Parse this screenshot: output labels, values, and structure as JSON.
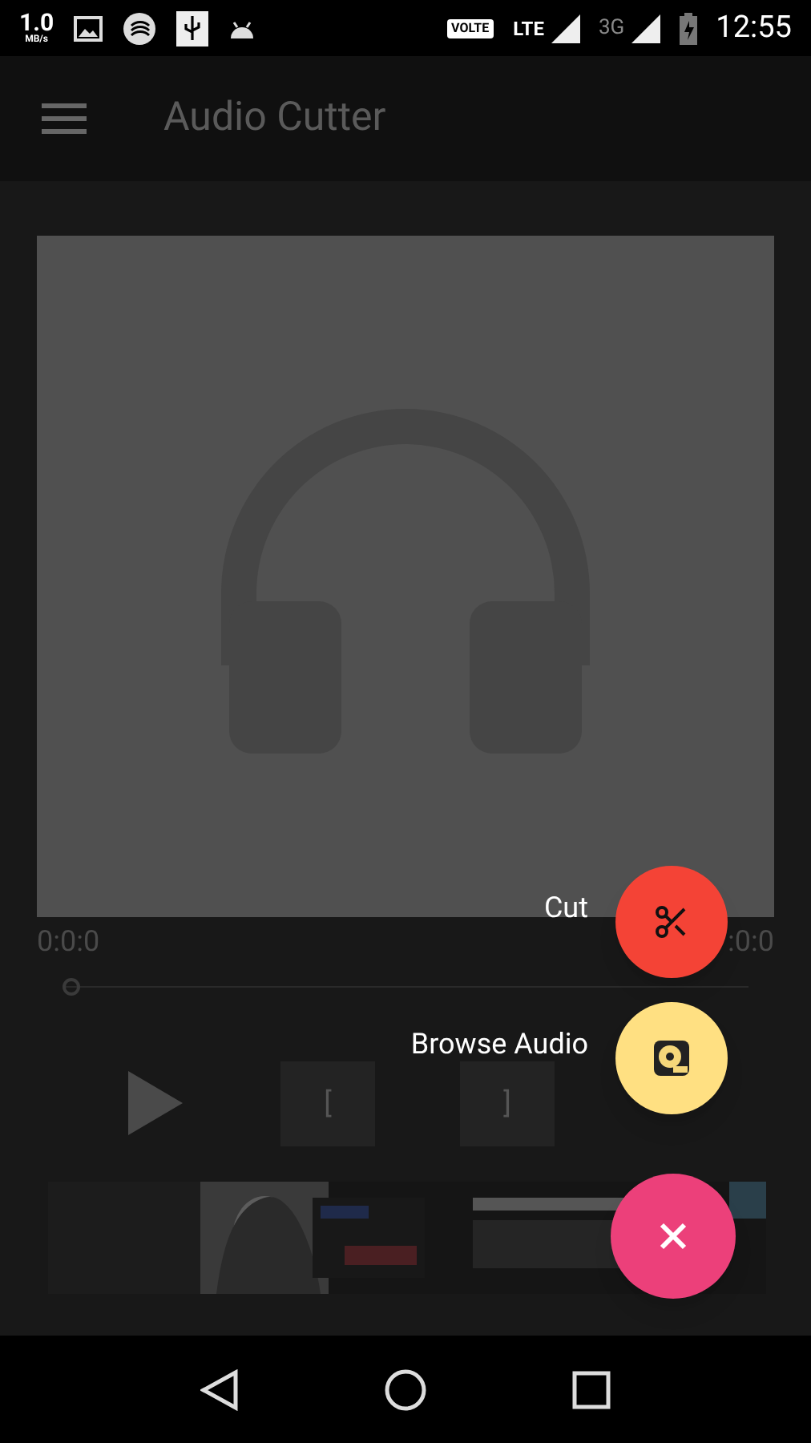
{
  "status_bar": {
    "speed": "1.0",
    "speed_unit": "MB/s",
    "volte": "VOLTE",
    "lte": "LTE",
    "network": "3G",
    "time": "12:55"
  },
  "toolbar": {
    "title": "Audio Cutter"
  },
  "player": {
    "start_time": "0:0:0",
    "end_time": ":0:0",
    "seek": {
      "level": 0
    },
    "mark_buttons": [
      "[",
      "]"
    ]
  },
  "fab_menu": {
    "items": [
      {
        "label": "Cut",
        "kind": "cut"
      },
      {
        "label": "Browse Audio",
        "kind": "browse"
      }
    ]
  }
}
